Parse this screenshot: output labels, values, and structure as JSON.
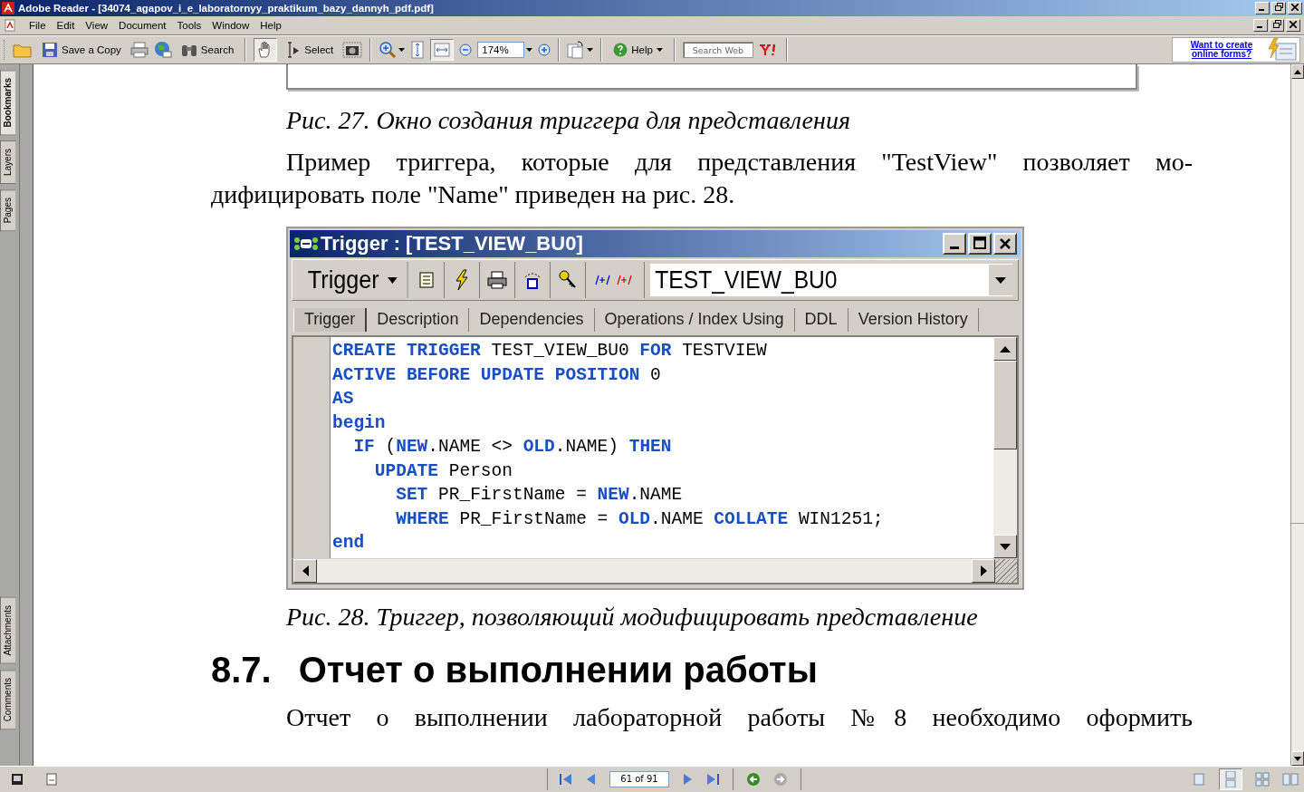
{
  "window": {
    "title": "Adobe Reader - [34074_agapov_i_e_laboratornyy_praktikum_bazy_dannyh_pdf.pdf]"
  },
  "menu": [
    "File",
    "Edit",
    "View",
    "Document",
    "Tools",
    "Window",
    "Help"
  ],
  "toolbar": {
    "save_label": "Save a Copy",
    "search_label": "Search",
    "hand_pressed": true,
    "select_label": "Select",
    "fit_width_pressed": true,
    "zoom_value": "174%",
    "help_label": "Help",
    "web_search_placeholder": "Search Web",
    "promo_link": "Want to create online forms?"
  },
  "nav_tabs": [
    {
      "label": "Bookmarks",
      "selected": true
    },
    {
      "label": "Layers",
      "selected": false
    },
    {
      "label": "Pages",
      "selected": false
    },
    {
      "label": "Attachments",
      "selected": false
    },
    {
      "label": "Comments",
      "selected": false
    }
  ],
  "document": {
    "caption_1": "Рис. 27. Окно создания триггера для представления",
    "paragraph_1": "Пример триггера, которые для представления \"TestView\" позволяет мо-дифицировать поле \"Name\" приведен на рис. 28.",
    "figure": {
      "title": "Trigger : [TEST_VIEW_BU0]",
      "object_type": "Trigger",
      "object_name": "TEST_VIEW_BU0",
      "tabs": [
        {
          "label": "Trigger",
          "selected": true
        },
        {
          "label": "Description",
          "selected": false
        },
        {
          "label": "Dependencies",
          "selected": false
        },
        {
          "label": "Operations / Index Using",
          "selected": false
        },
        {
          "label": "DDL",
          "selected": false
        },
        {
          "label": "Version History",
          "selected": false
        }
      ],
      "code": [
        [
          {
            "text": "CREATE TRIGGER",
            "kind": "keyword"
          },
          {
            "text": " TEST_VIEW_BU0 ",
            "kind": "plain"
          },
          {
            "text": "FOR",
            "kind": "keyword"
          },
          {
            "text": " TESTVIEW",
            "kind": "plain"
          }
        ],
        [
          {
            "text": "ACTIVE BEFORE UPDATE POSITION",
            "kind": "keyword"
          },
          {
            "text": " 0",
            "kind": "plain"
          }
        ],
        [
          {
            "text": "AS",
            "kind": "keyword"
          }
        ],
        [
          {
            "text": "begin",
            "kind": "keyword"
          }
        ],
        [
          {
            "text": "  IF",
            "kind": "keyword"
          },
          {
            "text": " (",
            "kind": "plain"
          },
          {
            "text": "NEW",
            "kind": "keyword"
          },
          {
            "text": ".NAME <> ",
            "kind": "plain"
          },
          {
            "text": "OLD",
            "kind": "keyword"
          },
          {
            "text": ".NAME) ",
            "kind": "plain"
          },
          {
            "text": "THEN",
            "kind": "keyword"
          }
        ],
        [
          {
            "text": "    UPDATE",
            "kind": "keyword"
          },
          {
            "text": " Person",
            "kind": "plain"
          }
        ],
        [
          {
            "text": "      SET",
            "kind": "keyword"
          },
          {
            "text": " PR_FirstName = ",
            "kind": "plain"
          },
          {
            "text": "NEW",
            "kind": "keyword"
          },
          {
            "text": ".NAME",
            "kind": "plain"
          }
        ],
        [
          {
            "text": "      WHERE",
            "kind": "keyword"
          },
          {
            "text": " PR_FirstName = ",
            "kind": "plain"
          },
          {
            "text": "OLD",
            "kind": "keyword"
          },
          {
            "text": ".NAME ",
            "kind": "plain"
          },
          {
            "text": "COLLATE",
            "kind": "keyword"
          },
          {
            "text": " WIN1251;",
            "kind": "plain"
          }
        ],
        [
          {
            "text": "end",
            "kind": "keyword"
          }
        ]
      ]
    },
    "caption_2": "Рис. 28. Триггер, позволяющий модифицировать представление",
    "heading_number": "8.7.",
    "heading": "Отчет о выполнении работы",
    "paragraph_2": "Отчет о выполнении лабораторной работы №8 необходимо оформить"
  },
  "status_bar": {
    "page": "61 of 91"
  }
}
